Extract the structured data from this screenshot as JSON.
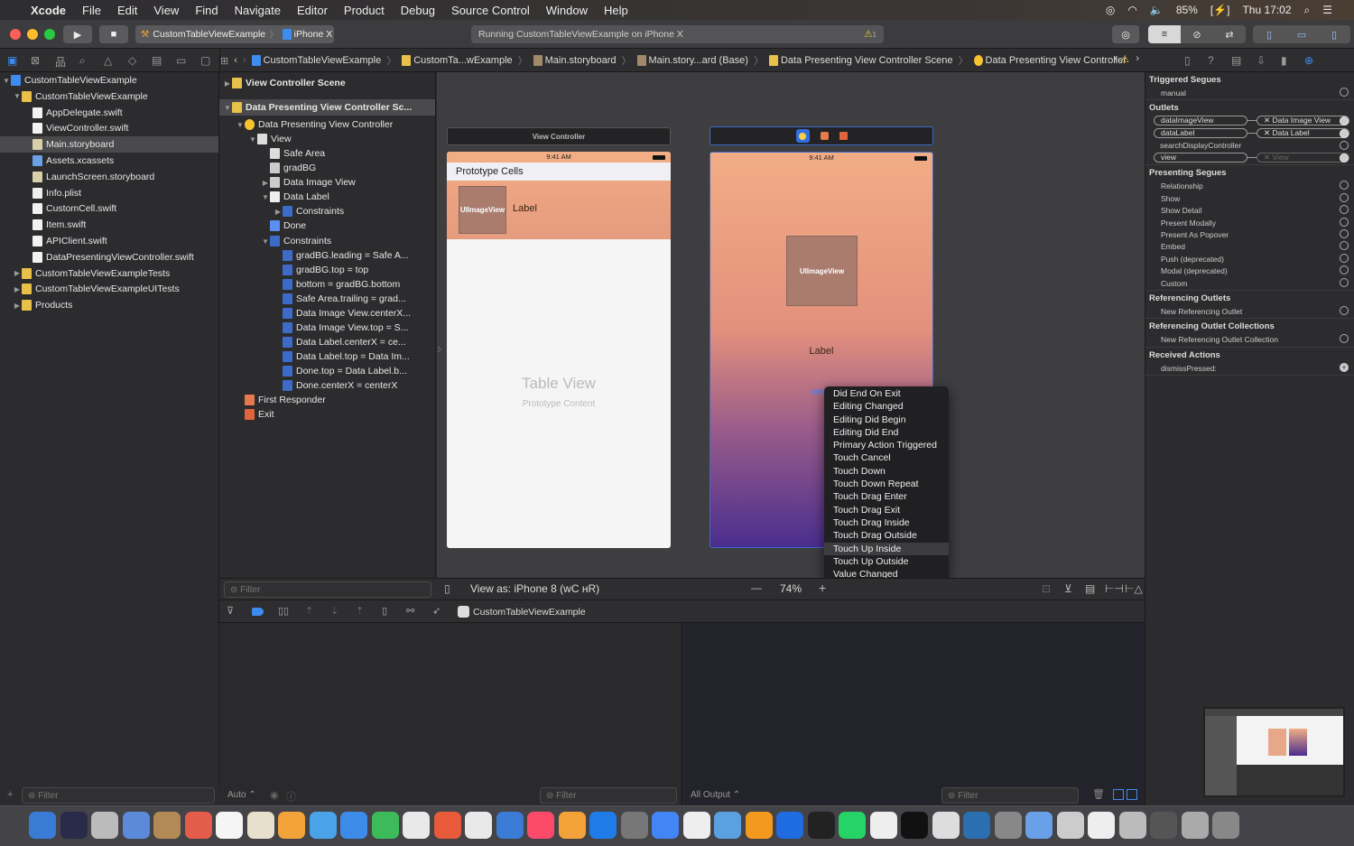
{
  "menubar": {
    "app": "Xcode",
    "items": [
      "File",
      "Edit",
      "View",
      "Find",
      "Navigate",
      "Editor",
      "Product",
      "Debug",
      "Source Control",
      "Window",
      "Help"
    ],
    "battery": "85%",
    "clock": "Thu 17:02"
  },
  "toolbar": {
    "scheme": "CustomTableViewExample",
    "device": "iPhone X",
    "activity": "Running CustomTableViewExample on iPhone X",
    "warning_count": "1"
  },
  "jumpbar": [
    "CustomTableViewExample",
    "CustomTa...wExample",
    "Main.storyboard",
    "Main.story...ard (Base)",
    "Data Presenting View Controller Scene",
    "Data Presenting View Controller"
  ],
  "navigator": {
    "filter_placeholder": "Filter",
    "items": [
      {
        "label": "CustomTableViewExample",
        "level": 0,
        "open": true,
        "icon": "project"
      },
      {
        "label": "CustomTableViewExample",
        "level": 1,
        "open": true,
        "icon": "folder"
      },
      {
        "label": "AppDelegate.swift",
        "level": 2,
        "icon": "swift"
      },
      {
        "label": "ViewController.swift",
        "level": 2,
        "icon": "swift"
      },
      {
        "label": "Main.storyboard",
        "level": 2,
        "icon": "storyboard",
        "selected": true
      },
      {
        "label": "Assets.xcassets",
        "level": 2,
        "icon": "assets"
      },
      {
        "label": "LaunchScreen.storyboard",
        "level": 2,
        "icon": "storyboard"
      },
      {
        "label": "Info.plist",
        "level": 2,
        "icon": "plist"
      },
      {
        "label": "CustomCell.swift",
        "level": 2,
        "icon": "swift"
      },
      {
        "label": "Item.swift",
        "level": 2,
        "icon": "swift"
      },
      {
        "label": "APIClient.swift",
        "level": 2,
        "icon": "swift"
      },
      {
        "label": "DataPresentingViewController.swift",
        "level": 2,
        "icon": "swift"
      },
      {
        "label": "CustomTableViewExampleTests",
        "level": 1,
        "open": false,
        "icon": "folder"
      },
      {
        "label": "CustomTableViewExampleUITests",
        "level": 1,
        "open": false,
        "icon": "folder"
      },
      {
        "label": "Products",
        "level": 1,
        "open": false,
        "icon": "folder"
      }
    ]
  },
  "outline": {
    "filter_placeholder": "Filter",
    "items": [
      {
        "label": "View Controller Scene",
        "level": 0,
        "open": false,
        "icon": "scene",
        "bold": true
      },
      {
        "label": "Data Presenting View Controller Sc...",
        "level": 0,
        "open": true,
        "icon": "scene",
        "bold": true,
        "selected": true
      },
      {
        "label": "Data Presenting View Controller",
        "level": 1,
        "open": true,
        "icon": "vc"
      },
      {
        "label": "View",
        "level": 2,
        "open": true,
        "icon": "view"
      },
      {
        "label": "Safe Area",
        "level": 3,
        "icon": "view"
      },
      {
        "label": "gradBG",
        "level": 3,
        "icon": "image"
      },
      {
        "label": "Data Image View",
        "level": 3,
        "open": false,
        "icon": "image"
      },
      {
        "label": "Data Label",
        "level": 3,
        "open": true,
        "icon": "label"
      },
      {
        "label": "Constraints",
        "level": 4,
        "open": false,
        "icon": "constraint"
      },
      {
        "label": "Done",
        "level": 3,
        "icon": "button"
      },
      {
        "label": "Constraints",
        "level": 3,
        "open": true,
        "icon": "constraint"
      },
      {
        "label": "gradBG.leading = Safe A...",
        "level": 4,
        "icon": "constraint"
      },
      {
        "label": "gradBG.top = top",
        "level": 4,
        "icon": "constraint"
      },
      {
        "label": "bottom = gradBG.bottom",
        "level": 4,
        "icon": "constraint"
      },
      {
        "label": "Safe Area.trailing = grad...",
        "level": 4,
        "icon": "constraint"
      },
      {
        "label": "Data Image View.centerX...",
        "level": 4,
        "icon": "constraint"
      },
      {
        "label": "Data Image View.top = S...",
        "level": 4,
        "icon": "constraint"
      },
      {
        "label": "Data Label.centerX = ce...",
        "level": 4,
        "icon": "constraint"
      },
      {
        "label": "Data Label.top = Data Im...",
        "level": 4,
        "icon": "constraint"
      },
      {
        "label": "Done.top = Data Label.b...",
        "level": 4,
        "icon": "constraint"
      },
      {
        "label": "Done.centerX = centerX",
        "level": 4,
        "icon": "constraint"
      },
      {
        "label": "First Responder",
        "level": 1,
        "icon": "responder"
      },
      {
        "label": "Exit",
        "level": 1,
        "icon": "exit"
      }
    ]
  },
  "canvas": {
    "vc1": {
      "title": "View Controller",
      "time": "9:41 AM",
      "section": "Prototype Cells",
      "cell_image": "UIImageView",
      "cell_label": "Label",
      "table_title": "Table View",
      "table_sub": "Prototype Content"
    },
    "vc2": {
      "time": "9:41 AM",
      "image": "UIImageView",
      "label": "Label"
    },
    "view_as": "View as: iPhone 8 (ᴡC ʜR)",
    "zoom": "74%"
  },
  "popup": {
    "items": [
      "Did End On Exit",
      "Editing Changed",
      "Editing Did Begin",
      "Editing Did End",
      "Primary Action Triggered",
      "Touch Cancel",
      "Touch Down",
      "Touch Down Repeat",
      "Touch Drag Enter",
      "Touch Drag Exit",
      "Touch Drag Inside",
      "Touch Drag Outside",
      "Touch Up Inside",
      "Touch Up Outside",
      "Value Changed"
    ],
    "highlighted": "Touch Up Inside"
  },
  "debug": {
    "target": "CustomTableViewExample",
    "auto": "Auto ⌃",
    "output": "All Output ⌃",
    "filter": "Filter"
  },
  "inspector": {
    "triggered": {
      "title": "Triggered Segues",
      "items": [
        "manual"
      ]
    },
    "outlets": {
      "title": "Outlets",
      "items": [
        {
          "name": "dataImageView",
          "target": "Data Image View"
        },
        {
          "name": "dataLabel",
          "target": "Data Label"
        },
        {
          "name": "searchDisplayController"
        },
        {
          "name": "view",
          "target": "View"
        }
      ]
    },
    "presenting": {
      "title": "Presenting Segues",
      "items": [
        "Relationship",
        "Show",
        "Show Detail",
        "Present Modally",
        "Present As Popover",
        "Embed",
        "Push (deprecated)",
        "Modal (deprecated)",
        "Custom"
      ]
    },
    "ref_outlets": {
      "title": "Referencing Outlets",
      "items": [
        "New Referencing Outlet"
      ]
    },
    "ref_collections": {
      "title": "Referencing Outlet Collections",
      "items": [
        "New Referencing Outlet Collection"
      ]
    },
    "actions": {
      "title": "Received Actions",
      "items": [
        "dismissPressed:"
      ]
    }
  },
  "colors": {
    "accent": "#3b82f6",
    "gradient_top": "#f2ad85",
    "gradient_bottom": "#4a2e8e",
    "folder": "#e8c04a"
  }
}
